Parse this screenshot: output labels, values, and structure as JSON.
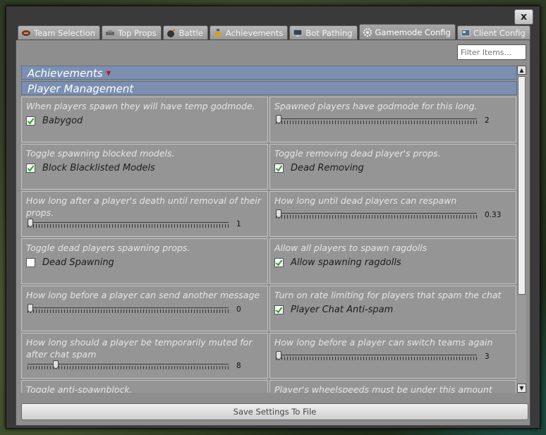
{
  "close_label": "x",
  "tabs": [
    {
      "label": "Team Selection",
      "icon": "football-icon",
      "active": false
    },
    {
      "label": "Top Props",
      "icon": "car-icon",
      "active": false
    },
    {
      "label": "Battle",
      "icon": "bomb-icon",
      "active": false
    },
    {
      "label": "Achievements",
      "icon": "medal-icon",
      "active": false
    },
    {
      "label": "Bot Pathing",
      "icon": "monitor-icon",
      "active": false
    },
    {
      "label": "Gamemode Config",
      "icon": "gear-icon",
      "active": true
    },
    {
      "label": "Client Config",
      "icon": "client-icon",
      "active": false
    }
  ],
  "filter": {
    "placeholder": "Filter Items..."
  },
  "sections": {
    "achievements": "Achievements",
    "player_management": "Player Management"
  },
  "settings": [
    {
      "desc": "When players spawn they will have temp godmode.",
      "type": "checkbox",
      "label": "Babygod",
      "checked": true
    },
    {
      "desc": "Spawned players have godmode for this long.",
      "type": "slider",
      "value": "2",
      "fraction": 0.0
    },
    {
      "desc": "Toggle spawning blocked models.",
      "type": "checkbox",
      "label": "Block Blacklisted Models",
      "checked": true
    },
    {
      "desc": "Toggle removing dead player's props.",
      "type": "checkbox",
      "label": "Dead Removing",
      "checked": true
    },
    {
      "desc": "How long after a player's death until removal of their props.",
      "type": "slider",
      "value": "1",
      "fraction": 0.0
    },
    {
      "desc": "How long until dead players can respawn",
      "type": "slider",
      "value": "0.33",
      "fraction": 0.0
    },
    {
      "desc": "Toggle dead players spawning props.",
      "type": "checkbox",
      "label": "Dead Spawning",
      "checked": false
    },
    {
      "desc": "Allow all players to spawn ragdolls",
      "type": "checkbox",
      "label": "Allow spawning ragdolls",
      "checked": true
    },
    {
      "desc": "How long before a player can send another message",
      "type": "slider",
      "value": "0",
      "fraction": 0.0
    },
    {
      "desc": "Turn on rate limiting for players that spam the chat",
      "type": "checkbox",
      "label": "Player Chat Anti-spam",
      "checked": true
    },
    {
      "desc": "How long should a player be temporarily muted for after chat spam",
      "type": "slider",
      "value": "8",
      "fraction": 0.13
    },
    {
      "desc": "How long before a player can switch teams again",
      "type": "slider",
      "value": "3",
      "fraction": 0.0
    },
    {
      "desc": "Toggle anti-spawnblock.",
      "type": "partial"
    },
    {
      "desc": "Player's wheelspeeds must be under this amount",
      "type": "partial"
    }
  ],
  "save_label": "Save Settings To File",
  "colors": {
    "section_header": "#7b8fb0",
    "check": "#2f9a2f"
  }
}
